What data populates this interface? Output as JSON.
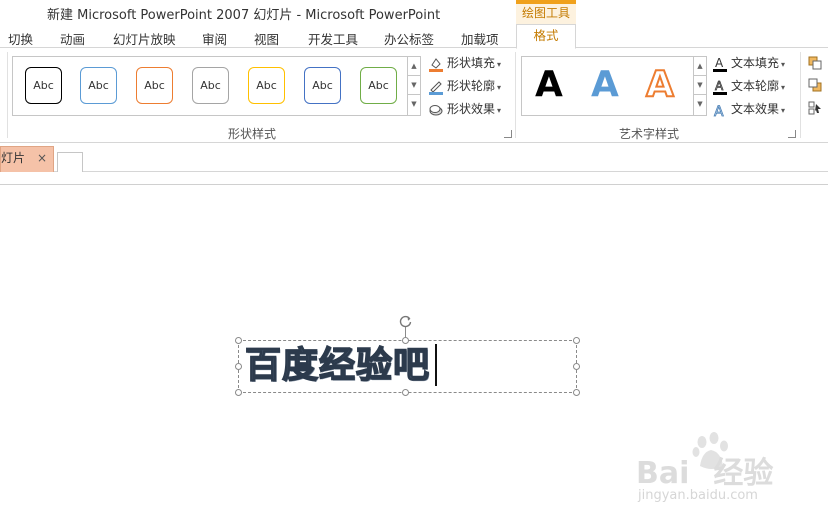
{
  "window": {
    "title": "新建 Microsoft PowerPoint 2007 幻灯片 - Microsoft PowerPoint",
    "context_tab_header": "绘图工具"
  },
  "tabs": [
    {
      "label": "切换"
    },
    {
      "label": "动画"
    },
    {
      "label": "幻灯片放映"
    },
    {
      "label": "审阅"
    },
    {
      "label": "视图"
    },
    {
      "label": "开发工具"
    },
    {
      "label": "办公标签"
    },
    {
      "label": "加载项"
    },
    {
      "label": "格式",
      "active": true
    }
  ],
  "shape_styles": {
    "group_label": "形状样式",
    "swatches": [
      {
        "label": "Abc",
        "color": "#000000"
      },
      {
        "label": "Abc",
        "color": "#5b9bd5"
      },
      {
        "label": "Abc",
        "color": "#ed7d31"
      },
      {
        "label": "Abc",
        "color": "#a5a5a5"
      },
      {
        "label": "Abc",
        "color": "#ffc000"
      },
      {
        "label": "Abc",
        "color": "#4472c4"
      },
      {
        "label": "Abc",
        "color": "#70ad47"
      }
    ],
    "fill_label": "形状填充",
    "outline_label": "形状轮廓",
    "effects_label": "形状效果"
  },
  "wordart_styles": {
    "group_label": "艺术字样式",
    "samples": [
      {
        "letter": "A",
        "color": "#000000"
      },
      {
        "letter": "A",
        "color": "#5b9bd5"
      },
      {
        "letter": "A",
        "color": "#ed7d31"
      }
    ],
    "text_fill_label": "文本填充",
    "text_outline_label": "文本轮廓",
    "text_effects_label": "文本效果"
  },
  "slide_tabs": {
    "current_label": "幻灯片",
    "close_glyph": "×"
  },
  "slide": {
    "text": "百度经验吧"
  },
  "watermark": {
    "brand": "Bai",
    "brand2": "经验",
    "url": "jingyan.baidu.com"
  }
}
